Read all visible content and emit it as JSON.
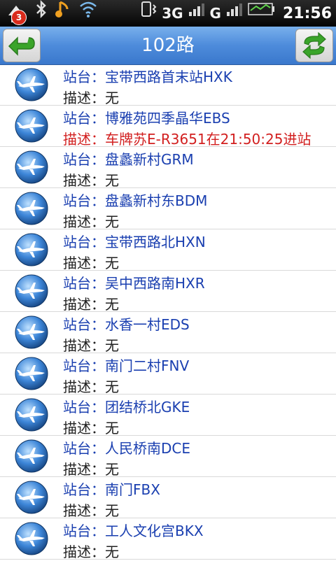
{
  "status_bar": {
    "notification_count": "3",
    "network_label_1": "3G",
    "network_label_2": "G",
    "clock": "21:56"
  },
  "title_bar": {
    "title": "102路"
  },
  "stations": [
    {
      "station": "站台：宝带西路首末站HXK",
      "description": "描述：无",
      "alert": false
    },
    {
      "station": "站台：博雅苑四季晶华EBS",
      "description": "描述：车牌苏E-R3651在21:50:25进站",
      "alert": true
    },
    {
      "station": "站台：盘蠡新村GRM",
      "description": "描述：无",
      "alert": false
    },
    {
      "station": "站台：盘蠡新村东BDM",
      "description": "描述：无",
      "alert": false
    },
    {
      "station": "站台：宝带西路北HXN",
      "description": "描述：无",
      "alert": false
    },
    {
      "station": "站台：吴中西路南HXR",
      "description": "描述：无",
      "alert": false
    },
    {
      "station": "站台：水香一村EDS",
      "description": "描述：无",
      "alert": false
    },
    {
      "station": "站台：南门二村FNV",
      "description": "描述：无",
      "alert": false
    },
    {
      "station": "站台：团结桥北GKE",
      "description": "描述：无",
      "alert": false
    },
    {
      "station": "站台：人民桥南DCE",
      "description": "描述：无",
      "alert": false
    },
    {
      "station": "站台：南门FBX",
      "description": "描述：无",
      "alert": false
    },
    {
      "station": "站台：工人文化宫BKX",
      "description": "描述：无",
      "alert": false
    }
  ],
  "colors": {
    "title_bar": "#4d8bdb",
    "station_text": "#1a3fb0",
    "alert_text": "#d22020",
    "arrow_green": "#3aa42a"
  }
}
